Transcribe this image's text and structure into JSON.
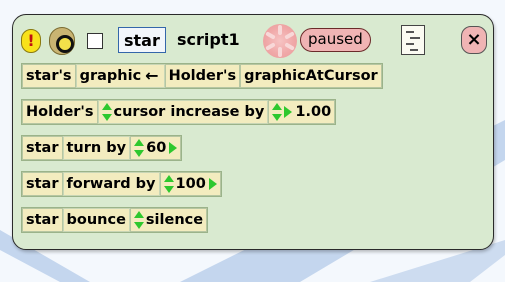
{
  "header": {
    "player_name": "star",
    "script_name": "script1",
    "status_label": "paused",
    "alert_glyph": "!",
    "close_glyph": "×"
  },
  "rows": [
    {
      "player": "star's",
      "keyword": "graphic",
      "arrow": "←",
      "holder": "Holder's",
      "value": "graphicAtCursor"
    },
    {
      "player": "Holder's",
      "command": "cursor increase by",
      "value": "1.00"
    },
    {
      "player": "star",
      "command": "turn by",
      "value": "60"
    },
    {
      "player": "star",
      "command": "forward by",
      "value": "100"
    },
    {
      "player": "star",
      "command": "bounce",
      "value": "silence"
    }
  ],
  "icons": {
    "alert": "exclamation-icon",
    "menu": "script-menu-icon",
    "close": "close-icon",
    "tick": "tick-rate-icon"
  },
  "colors": {
    "script_background": "#d9ead0",
    "tile": "#f3ecbf",
    "paused": "#f0b4b4",
    "arrow_green": "#2ec82e"
  }
}
